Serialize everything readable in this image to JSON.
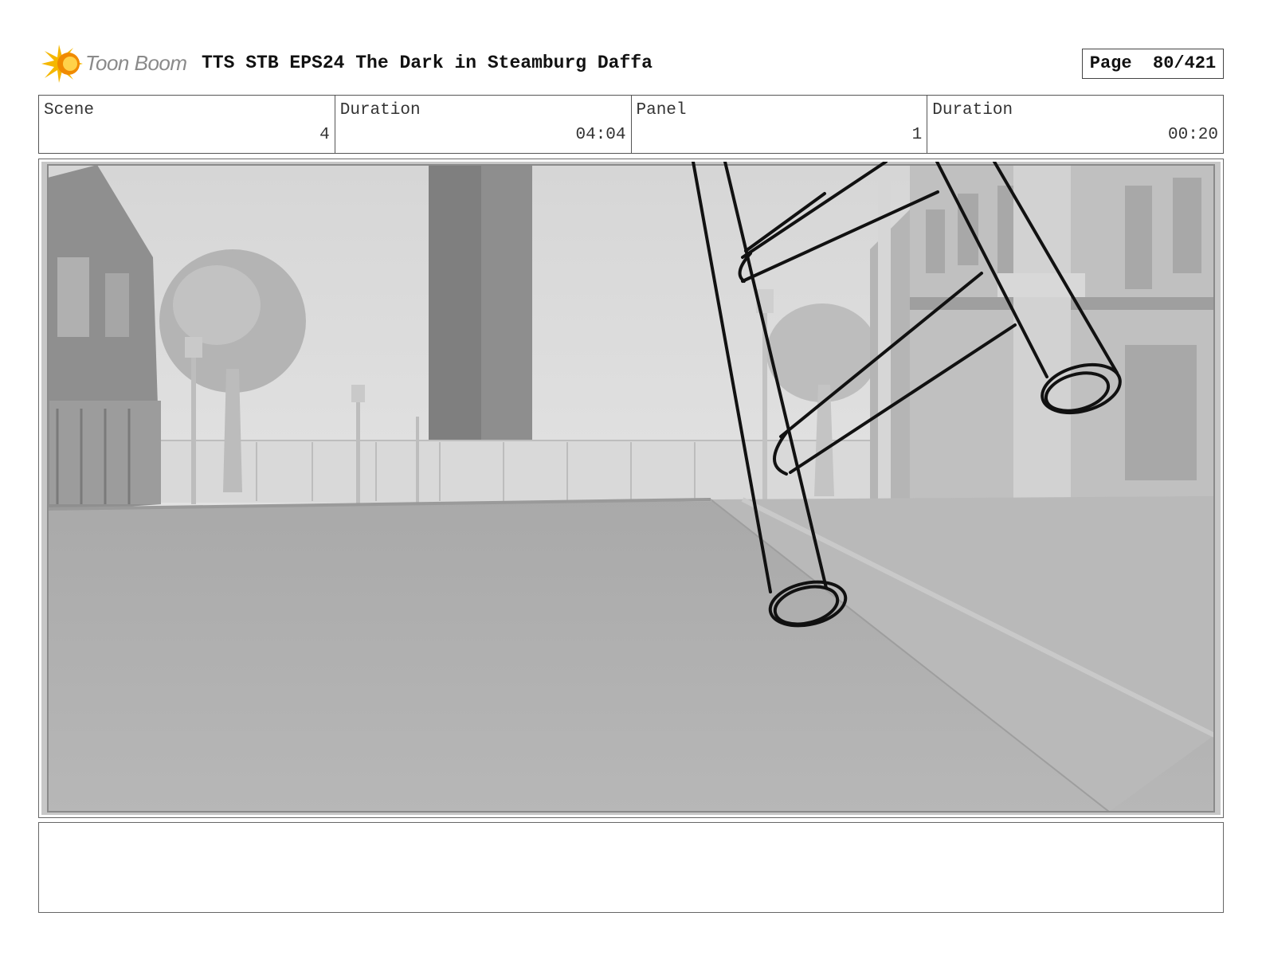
{
  "header": {
    "brand": "Toon Boom",
    "title": "TTS STB EPS24 The Dark in Steamburg Daffa",
    "page_label": "Page",
    "page_value": "80/421"
  },
  "info": {
    "scene_label": "Scene",
    "scene_value": "4",
    "scene_duration_label": "Duration",
    "scene_duration_value": "04:04",
    "panel_label": "Panel",
    "panel_value": "1",
    "panel_duration_label": "Duration",
    "panel_duration_value": "00:20"
  },
  "colors": {
    "logo_yellow": "#f5b700",
    "logo_orange": "#f08a00",
    "logo_text": "#8a8a8a",
    "sketch_stroke": "#111111"
  },
  "notes": {
    "text": ""
  }
}
